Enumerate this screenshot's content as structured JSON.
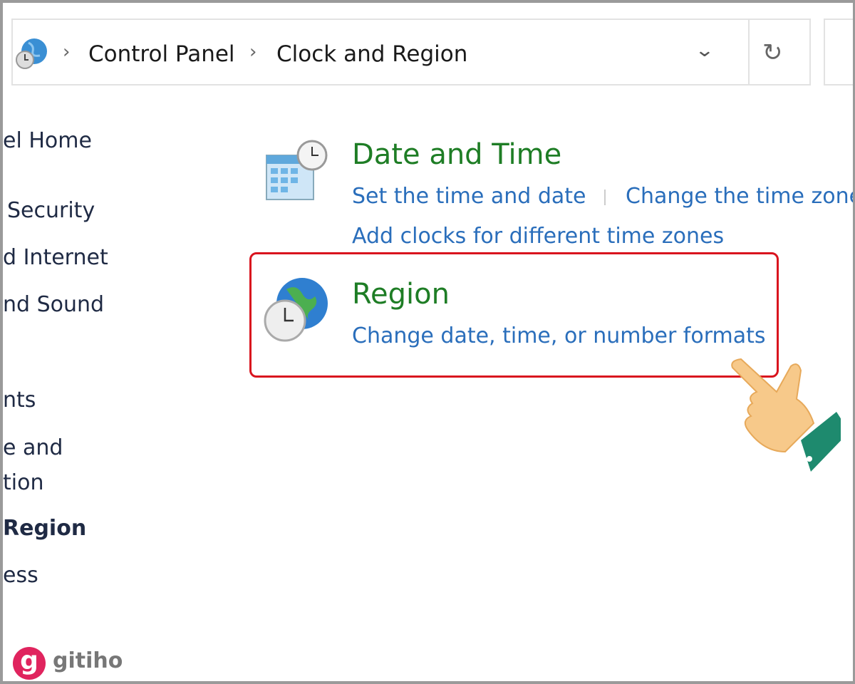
{
  "breadcrumb": {
    "items": [
      "Control Panel",
      "Clock and Region"
    ]
  },
  "sidebar": {
    "items": [
      "el Home",
      "Security",
      "d Internet",
      "nd Sound",
      "nts",
      "e and",
      "tion",
      "Region",
      "ess"
    ],
    "active": "Region"
  },
  "sections": [
    {
      "title": "Date and Time",
      "links": [
        "Set the time and date",
        "Change the time zone",
        "Add clocks for different time zones"
      ]
    },
    {
      "title": "Region",
      "links": [
        "Change date, time, or number formats"
      ]
    }
  ],
  "watermark": "gitiho",
  "colors": {
    "title": "#1e7d25",
    "link": "#2a6ebb",
    "highlight": "#d9141e"
  }
}
